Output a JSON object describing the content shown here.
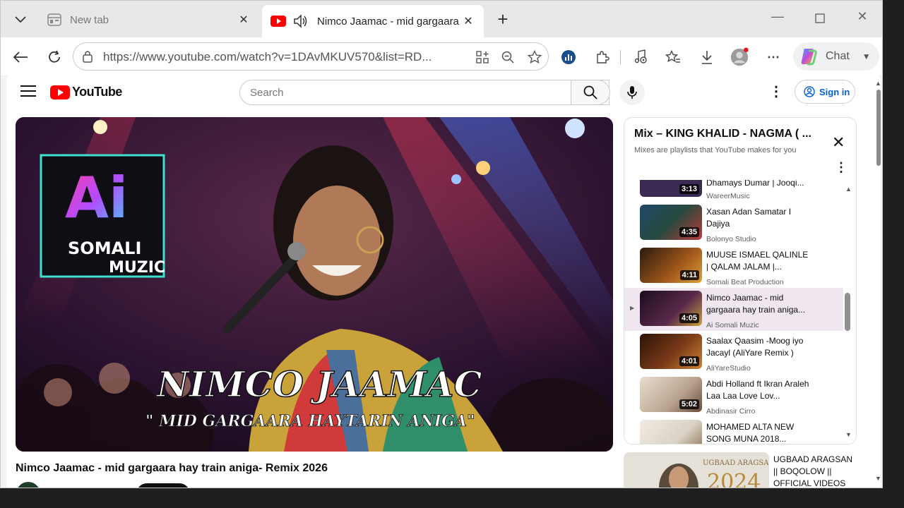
{
  "browser": {
    "tabs": [
      {
        "title": "New tab",
        "active": false
      },
      {
        "title": "Nimco Jaamac - mid gargaara",
        "active": true
      }
    ],
    "address": "https://www.youtube.com/watch?v=1DAvMKUV570&list=RD...",
    "chat_label": "Chat"
  },
  "youtube": {
    "logo_text": "YouTube",
    "search_placeholder": "Search",
    "signin_label": "Sign in",
    "video_title": "Nimco Jaamac - mid gargaara hay train aniga- Remix 2026",
    "thumbnail": {
      "badge_line1": "SOMALI",
      "badge_line2": "MUZIC",
      "headline": "NIMCO JAAMAC",
      "subline": "\" MID GARGAARA HAYTARIN ANIGA\""
    }
  },
  "playlist": {
    "title": "Mix – KING KHALID - NAGMA ( ...",
    "subtitle": "Mixes are playlists that YouTube makes for you",
    "items": [
      {
        "title": "Dhamays Dumar | Jooqi...",
        "channel": "WareerMusic",
        "duration": "3:13",
        "active": false,
        "color": "#3a2a55"
      },
      {
        "title": "Xasan Adan Samatar I Dajiya",
        "channel": "Bolonyo Studio",
        "duration": "4:35",
        "active": false,
        "color": "#274a3e"
      },
      {
        "title": "MUUSE ISMAEL QALINLE | QALAM JALAM |...",
        "channel": "Somali Beat Production",
        "duration": "4:11",
        "active": false,
        "color": "#7a3b10"
      },
      {
        "title": "Nimco Jaamac - mid gargaara hay train aniga...",
        "channel": "Ai Somali Muzic",
        "duration": "4:05",
        "active": true,
        "color": "#3b1838"
      },
      {
        "title": "Saalax Qaasim -Moog iyo Jacayl (AliYare Remix )",
        "channel": "AliYareStudio",
        "duration": "4:01",
        "active": false,
        "color": "#5a2a12"
      },
      {
        "title": "Abdi Holland ft Ikran Araleh Laa Laa Love Lov...",
        "channel": "Abdinasir Cirro",
        "duration": "5:02",
        "active": false,
        "color": "#b9a48e"
      },
      {
        "title": "MOHAMED ALTA NEW SONG MUNA 2018...",
        "channel": "",
        "duration": "",
        "active": false,
        "color": "#d9d2c5"
      }
    ]
  },
  "recommended": {
    "title": "UGBAAD ARAGSAN || BOQOLOW || OFFICIAL VIDEOS",
    "thumb_caption": "UGBAAD ARAGSAN",
    "thumb_year": "2024"
  }
}
